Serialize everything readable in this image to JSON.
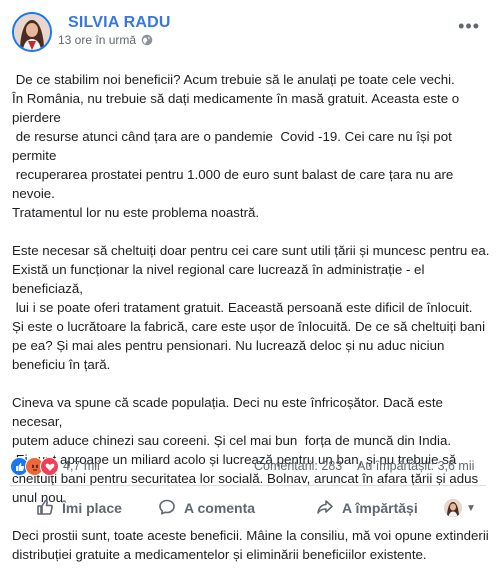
{
  "post": {
    "author": "SILVIA RADU",
    "time": "13 ore în urmă",
    "paragraphs": [
      " De ce stabilim noi beneficii? Acum trebuie să le anulați pe toate cele vechi.\nÎn România, nu trebuie să dați medicamente în masă gratuit. Aceasta este o pierdere\n de resurse atunci când țara are o pandemie  Covid -19. Cei care nu își pot permite\n recuperarea prostatei pentru 1.000 de euro sunt balast de care țara nu are nevoie.\nTratamentul lor nu este problema noastră.",
      "Este necesar să cheltuiți doar pentru cei care sunt utili țării și muncesc pentru ea.\nExistă un funcționar la nivel regional care lucrează în administrație - el beneficiază,\n lui i se poate oferi tratament gratuit. Eaceastă persoană este dificil de înlocuit.\nȘi este o lucrătoare la fabrică, care este ușor de înlocuită. De ce să cheltuiți bani\npe ea? Și mai ales pentru pensionari. Nu lucrează deloc și nu aduc niciun\nbeneficiu în țară.",
      "Cineva va spune că scade populația. Deci nu este înfricoșător. Dacă este necesar,\nputem aduce chinezi sau coreeni. Și cel mai bun  forța de muncă din India.\n Ei sunt aproape un miliard acolo și lucrează pentru un ban, și nu trebuie să\ncheltuiți bani pentru securitatea lor socială. Bolnav, aruncat în afara țării și adus\nunul nou.",
      "Deci prostii sunt, toate aceste beneficii. Mâine la consiliu, mă voi opune extinderii\ndistribuției gratuite a medicamentelor și eliminării beneficiilor existente."
    ]
  },
  "stats": {
    "reactions": "4,7 mii",
    "comments": "Comentarii: 283",
    "shares": "Au împărtășit: 3,6 mii"
  },
  "actions": {
    "like": "Îmi place",
    "comment": "A comenta",
    "share": "A împărtăși"
  },
  "icons": {
    "reactions": [
      "like-reaction-icon",
      "angry-reaction-icon",
      "love-reaction-icon"
    ],
    "privacy": "globe-icon",
    "more": "more-icon"
  },
  "colors": {
    "author": "#3578e5",
    "like": "#1877f2",
    "angry": "#f0663b",
    "love": "#f33e58"
  }
}
